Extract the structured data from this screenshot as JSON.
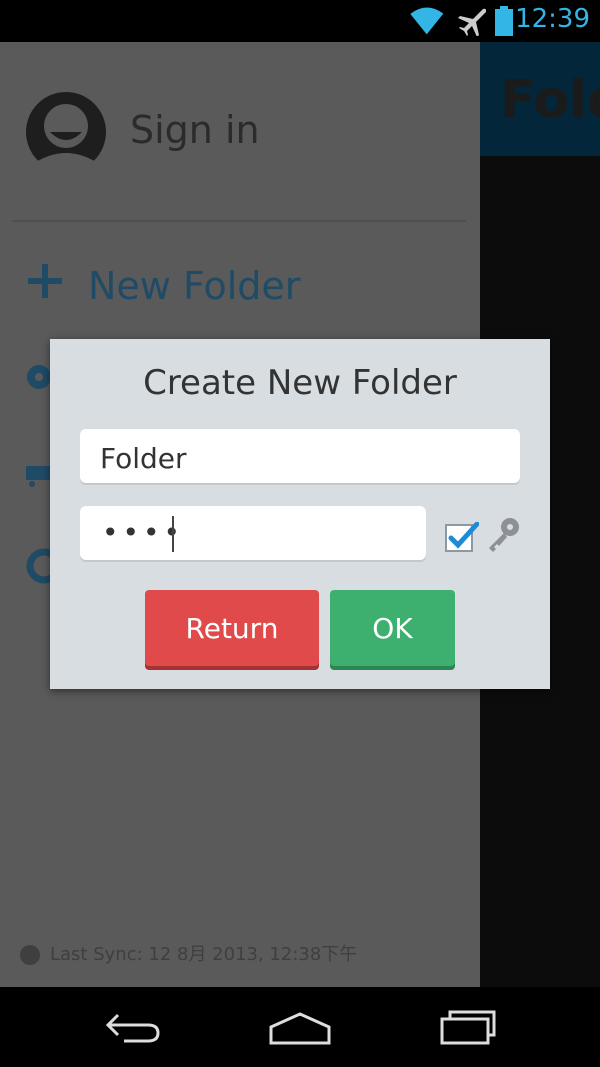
{
  "status_bar": {
    "time": "12:39",
    "icons": [
      "wifi-icon",
      "airplane-icon",
      "battery-icon"
    ],
    "accent_color": "#33b5e5"
  },
  "background_app": {
    "title_fragment": "Fold"
  },
  "drawer": {
    "sign_in_label": "Sign in",
    "new_folder_label": "New Folder",
    "menu_icons": [
      "flower-icon",
      "cart-icon",
      "lifebuoy-icon"
    ],
    "last_sync": "Last Sync: 12 8月 2013, 12:38下午",
    "accent_color": "#1f4b66"
  },
  "dialog": {
    "title": "Create New Folder",
    "name_value": "Folder",
    "password_masked": "••••",
    "password_checkbox_checked": true,
    "return_label": "Return",
    "ok_label": "OK",
    "return_color": "#e04a4a",
    "ok_color": "#3daf6f"
  },
  "nav_bar": {
    "buttons": [
      "back-icon",
      "home-icon",
      "recents-icon"
    ]
  }
}
